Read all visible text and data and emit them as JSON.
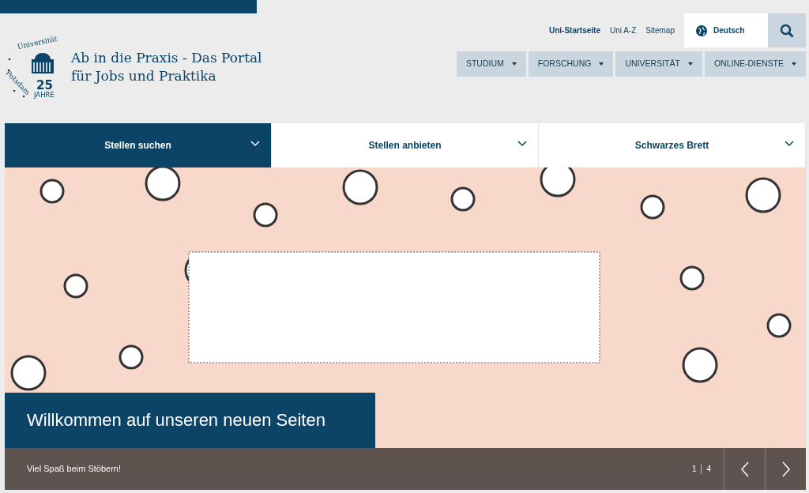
{
  "top_links": [
    {
      "label": "Uni-Startseite",
      "emphasis": true
    },
    {
      "label": "Uni A-Z",
      "emphasis": false
    },
    {
      "label": "Sitemap",
      "emphasis": false
    }
  ],
  "language": {
    "label": "Deutsch"
  },
  "logo": {
    "university": "Universität",
    "city": "Potsdam",
    "number": "25",
    "years": "JAHRE"
  },
  "site_title": "Ab in die Praxis - Das Portal für Jobs und Praktika",
  "main_nav": [
    {
      "label": "STUDIUM"
    },
    {
      "label": "FORSCHUNG"
    },
    {
      "label": "UNIVERSITÄT"
    },
    {
      "label": "ONLINE-DIENSTE"
    }
  ],
  "tabs": [
    {
      "label": "Stellen suchen",
      "selected": true
    },
    {
      "label": "Stellen anbieten",
      "selected": false
    },
    {
      "label": "Schwarzes Brett",
      "selected": false
    }
  ],
  "slider": {
    "kind": "picture",
    "headline": "Willkommen auf unseren neuen Seiten",
    "caption": "Viel Spaß beim Stöbern!",
    "current": "1",
    "total": "4"
  }
}
